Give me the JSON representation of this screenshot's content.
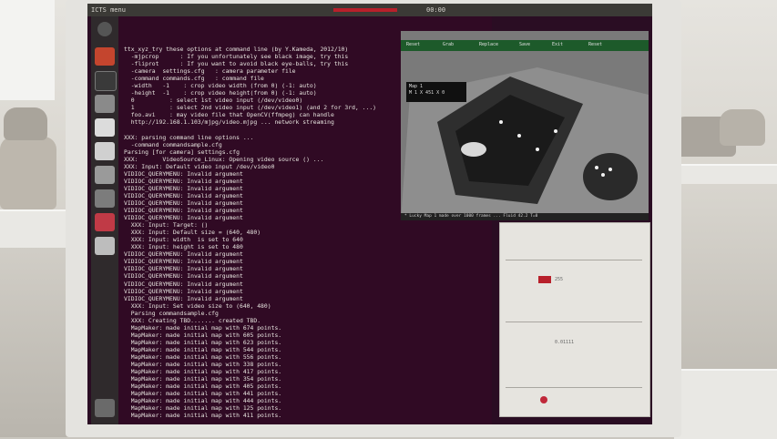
{
  "topbar": {
    "title": "ICTS menu",
    "indicator": "00:00"
  },
  "terminal": {
    "lines": [
      "ttx_xyz_try these options at command line (by Y.Kameda, 2012/10)",
      "  -mjpcrop      : If you unfortunately see black image, try this",
      "  -fliprot      : If you want to avoid black eye-balls, try this",
      "  -camera  settings.cfg   : camera parameter file",
      "  -command commands.cfg   : command file",
      "  -width   -1    : crop video width (from 0) (-1: auto)",
      "  -height  -1    : crop video height(from 0) (-1: auto)",
      "  0          : select 1st video input (/dev/video0)",
      "  1          : select 2nd video input (/dev/video1) (and 2 for 3rd, ...)",
      "  foo.avi    : may video file that OpenCV(ffmpeg) can handle",
      "  http://192.168.1.103/mjpg/video.mjpg ... network streaming",
      "",
      "XXX: parsing command line options ...",
      "  -command commandsample.cfg",
      "Parsing [for camera] settings.cfg",
      "XXX:       VideoSource_Linux: Opening video source () ...",
      "XXX: Input: Default video input /dev/video0",
      "VIDIOC_QUERYMENU: Invalid argument",
      "VIDIOC_QUERYMENU: Invalid argument",
      "VIDIOC_QUERYMENU: Invalid argument",
      "VIDIOC_QUERYMENU: Invalid argument",
      "VIDIOC_QUERYMENU: Invalid argument",
      "VIDIOC_QUERYMENU: Invalid argument",
      "VIDIOC_QUERYMENU: Invalid argument",
      "  XXX: Input: Target: ()",
      "  XXX: Input: Default size = (640, 480)",
      "  XXX: Input: width  is set to 640",
      "  XXX: Input: height is set to 480",
      "VIDIOC_QUERYMENU: Invalid argument",
      "VIDIOC_QUERYMENU: Invalid argument",
      "VIDIOC_QUERYMENU: Invalid argument",
      "VIDIOC_QUERYMENU: Invalid argument",
      "VIDIOC_QUERYMENU: Invalid argument",
      "VIDIOC_QUERYMENU: Invalid argument",
      "VIDIOC_QUERYMENU: Invalid argument",
      "  XXX: Input: Set video size to (640, 480)",
      "  Parsing commandsample.cfg",
      "  XXX: Creating TBD....... created TBD.",
      "  MapMaker: made initial map with 674 points.",
      "  MapMaker: made initial map with 605 points.",
      "  MapMaker: made initial map with 623 points.",
      "  MapMaker: made initial map with 544 points.",
      "  MapMaker: made initial map with 556 points.",
      "  MapMaker: made initial map with 338 points.",
      "  MapMaker: made initial map with 417 points.",
      "  MapMaker: made initial map with 354 points.",
      "  MapMaker: made initial map with 405 points.",
      "  MapMaker: made initial map with 441 points.",
      "  MapMaker: made initial map with 444 points.",
      "  MapMaker: made initial map with 125 points.",
      "  MapMaker: made initial map with 411 points."
    ]
  },
  "camera": {
    "menu": [
      "Reset",
      "Grab",
      "Replace",
      "Save",
      "Exit",
      "Reset"
    ],
    "hud": [
      "Map 1",
      "M 1 X 451 X 0"
    ],
    "caption": "* Lucky Map 1 made over 1000 frames ... Fluid 42.2 T=0"
  },
  "board": {
    "value1": "255",
    "value2": "0.01111"
  },
  "colors": {
    "terminal_bg": "#300a24",
    "terminal_fg": "#e7e4df",
    "menu_bg": "#1d5a2a",
    "accent": "#b8202b"
  }
}
